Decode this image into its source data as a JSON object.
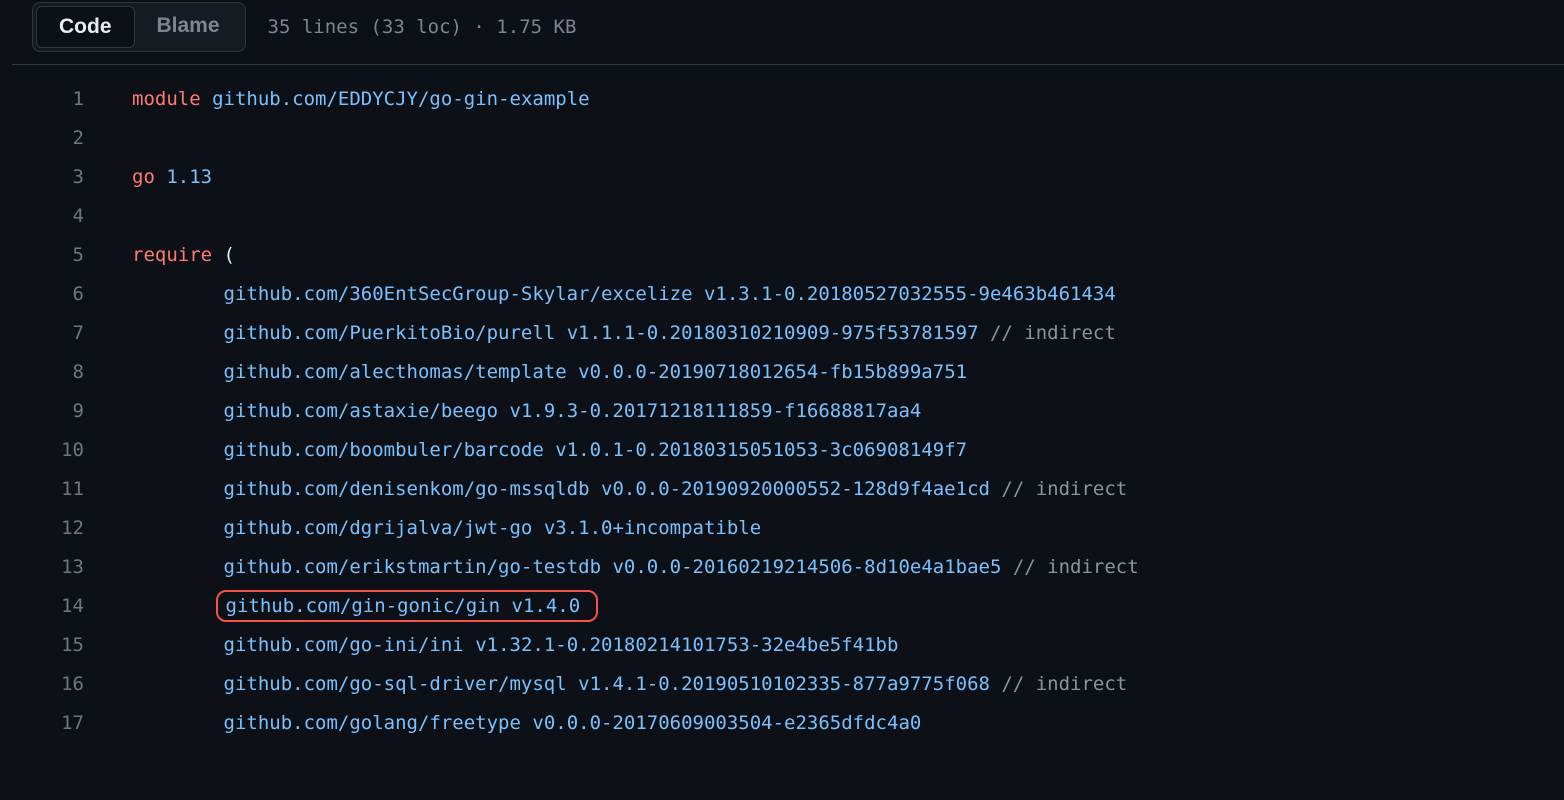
{
  "toolbar": {
    "code_tab": "Code",
    "blame_tab": "Blame",
    "file_info": "35 lines (33 loc) · 1.75 KB"
  },
  "lines": [
    {
      "n": 1,
      "indent": "",
      "tokens": [
        {
          "t": "kw",
          "v": "module"
        },
        {
          "t": "plain",
          "v": " "
        },
        {
          "t": "pkg",
          "v": "github.com/EDDYCJY/go-gin-example"
        }
      ]
    },
    {
      "n": 2,
      "indent": "",
      "tokens": []
    },
    {
      "n": 3,
      "indent": "",
      "tokens": [
        {
          "t": "kw",
          "v": "go"
        },
        {
          "t": "plain",
          "v": " "
        },
        {
          "t": "ver",
          "v": "1.13"
        }
      ]
    },
    {
      "n": 4,
      "indent": "",
      "tokens": []
    },
    {
      "n": 5,
      "indent": "",
      "tokens": [
        {
          "t": "kw",
          "v": "require"
        },
        {
          "t": "plain",
          "v": " ("
        }
      ]
    },
    {
      "n": 6,
      "indent": "        ",
      "tokens": [
        {
          "t": "pkg",
          "v": "github.com/360EntSecGroup-Skylar/excelize"
        },
        {
          "t": "plain",
          "v": " "
        },
        {
          "t": "ver",
          "v": "v1.3.1-0.20180527032555-9e463b461434"
        }
      ]
    },
    {
      "n": 7,
      "indent": "        ",
      "tokens": [
        {
          "t": "pkg",
          "v": "github.com/PuerkitoBio/purell"
        },
        {
          "t": "plain",
          "v": " "
        },
        {
          "t": "ver",
          "v": "v1.1.1-0.20180310210909-975f53781597"
        },
        {
          "t": "plain",
          "v": " "
        },
        {
          "t": "comment",
          "v": "// indirect"
        }
      ]
    },
    {
      "n": 8,
      "indent": "        ",
      "tokens": [
        {
          "t": "pkg",
          "v": "github.com/alecthomas/template"
        },
        {
          "t": "plain",
          "v": " "
        },
        {
          "t": "ver",
          "v": "v0.0.0-20190718012654-fb15b899a751"
        }
      ]
    },
    {
      "n": 9,
      "indent": "        ",
      "tokens": [
        {
          "t": "pkg",
          "v": "github.com/astaxie/beego"
        },
        {
          "t": "plain",
          "v": " "
        },
        {
          "t": "ver",
          "v": "v1.9.3-0.20171218111859-f16688817aa4"
        }
      ]
    },
    {
      "n": 10,
      "indent": "        ",
      "tokens": [
        {
          "t": "pkg",
          "v": "github.com/boombuler/barcode"
        },
        {
          "t": "plain",
          "v": " "
        },
        {
          "t": "ver",
          "v": "v1.0.1-0.20180315051053-3c06908149f7"
        }
      ]
    },
    {
      "n": 11,
      "indent": "        ",
      "tokens": [
        {
          "t": "pkg",
          "v": "github.com/denisenkom/go-mssqldb"
        },
        {
          "t": "plain",
          "v": " "
        },
        {
          "t": "ver",
          "v": "v0.0.0-20190920000552-128d9f4ae1cd"
        },
        {
          "t": "plain",
          "v": " "
        },
        {
          "t": "comment",
          "v": "// indirect"
        }
      ]
    },
    {
      "n": 12,
      "indent": "        ",
      "tokens": [
        {
          "t": "pkg",
          "v": "github.com/dgrijalva/jwt-go"
        },
        {
          "t": "plain",
          "v": " "
        },
        {
          "t": "ver",
          "v": "v3.1.0+incompatible"
        }
      ]
    },
    {
      "n": 13,
      "indent": "        ",
      "tokens": [
        {
          "t": "pkg",
          "v": "github.com/erikstmartin/go-testdb"
        },
        {
          "t": "plain",
          "v": " "
        },
        {
          "t": "ver",
          "v": "v0.0.0-20160219214506-8d10e4a1bae5"
        },
        {
          "t": "plain",
          "v": " "
        },
        {
          "t": "comment",
          "v": "// indirect"
        }
      ]
    },
    {
      "n": 14,
      "indent": "        ",
      "highlight": true,
      "tokens": [
        {
          "t": "pkg",
          "v": "github.com/gin-gonic/gin"
        },
        {
          "t": "plain",
          "v": " "
        },
        {
          "t": "ver",
          "v": "v1.4.0"
        }
      ]
    },
    {
      "n": 15,
      "indent": "        ",
      "tokens": [
        {
          "t": "pkg",
          "v": "github.com/go-ini/ini"
        },
        {
          "t": "plain",
          "v": " "
        },
        {
          "t": "ver",
          "v": "v1.32.1-0.20180214101753-32e4be5f41bb"
        }
      ]
    },
    {
      "n": 16,
      "indent": "        ",
      "tokens": [
        {
          "t": "pkg",
          "v": "github.com/go-sql-driver/mysql"
        },
        {
          "t": "plain",
          "v": " "
        },
        {
          "t": "ver",
          "v": "v1.4.1-0.20190510102335-877a9775f068"
        },
        {
          "t": "plain",
          "v": " "
        },
        {
          "t": "comment",
          "v": "// indirect"
        }
      ]
    },
    {
      "n": 17,
      "indent": "        ",
      "tokens": [
        {
          "t": "pkg",
          "v": "github.com/golang/freetype"
        },
        {
          "t": "plain",
          "v": " "
        },
        {
          "t": "ver",
          "v": "v0.0.0-20170609003504-e2365dfdc4a0"
        }
      ]
    }
  ]
}
